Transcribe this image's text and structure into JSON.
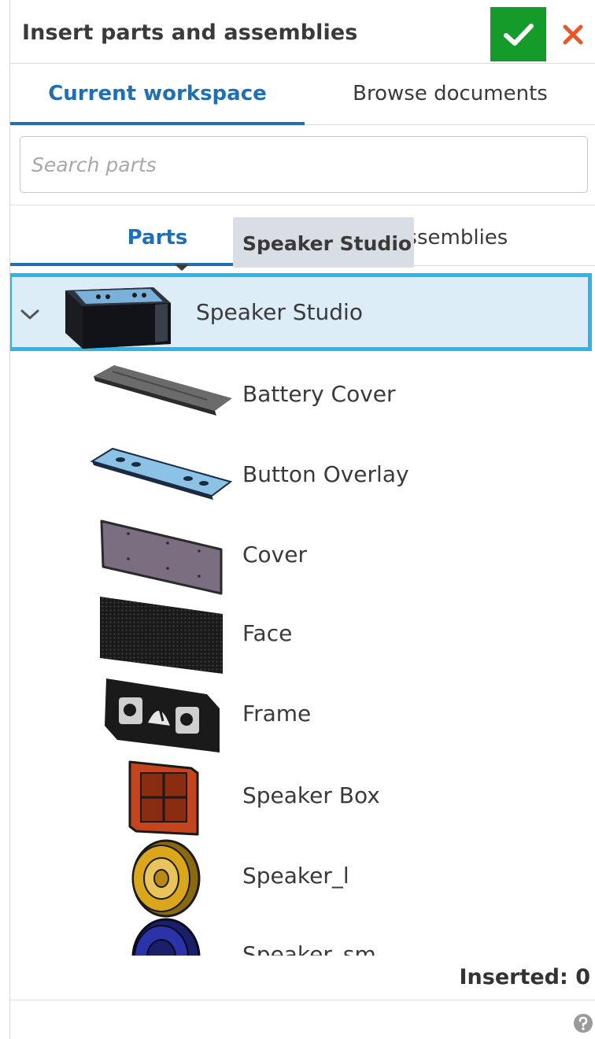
{
  "dialog": {
    "title": "Insert parts and assemblies",
    "confirm_icon": "check-icon",
    "close_icon": "close-icon",
    "confirm_color": "#149b29",
    "close_color": "#e8562a"
  },
  "workspace_tabs": [
    {
      "label": "Current workspace",
      "active": true
    },
    {
      "label": "Browse documents",
      "active": false
    }
  ],
  "search": {
    "placeholder": "Search parts",
    "value": ""
  },
  "type_tabs": [
    {
      "label": "Parts",
      "active": true
    },
    {
      "label": "Assemblies",
      "active": false
    }
  ],
  "tooltip": {
    "text": "Speaker Studio"
  },
  "assembly": {
    "label": "Speaker Studio",
    "expanded": true,
    "selected": true
  },
  "parts": [
    {
      "label": "Battery Cover"
    },
    {
      "label": "Button Overlay"
    },
    {
      "label": "Cover"
    },
    {
      "label": "Face"
    },
    {
      "label": "Frame"
    },
    {
      "label": "Speaker Box"
    },
    {
      "label": "Speaker_l"
    },
    {
      "label": "Speaker_sm"
    }
  ],
  "footer": {
    "inserted": "Inserted: 0",
    "help_icon": "help-icon"
  },
  "colors": {
    "accent": "#1f6fb3",
    "selection_border": "#2bb5ea",
    "selection_fill": "#dcedf8"
  }
}
